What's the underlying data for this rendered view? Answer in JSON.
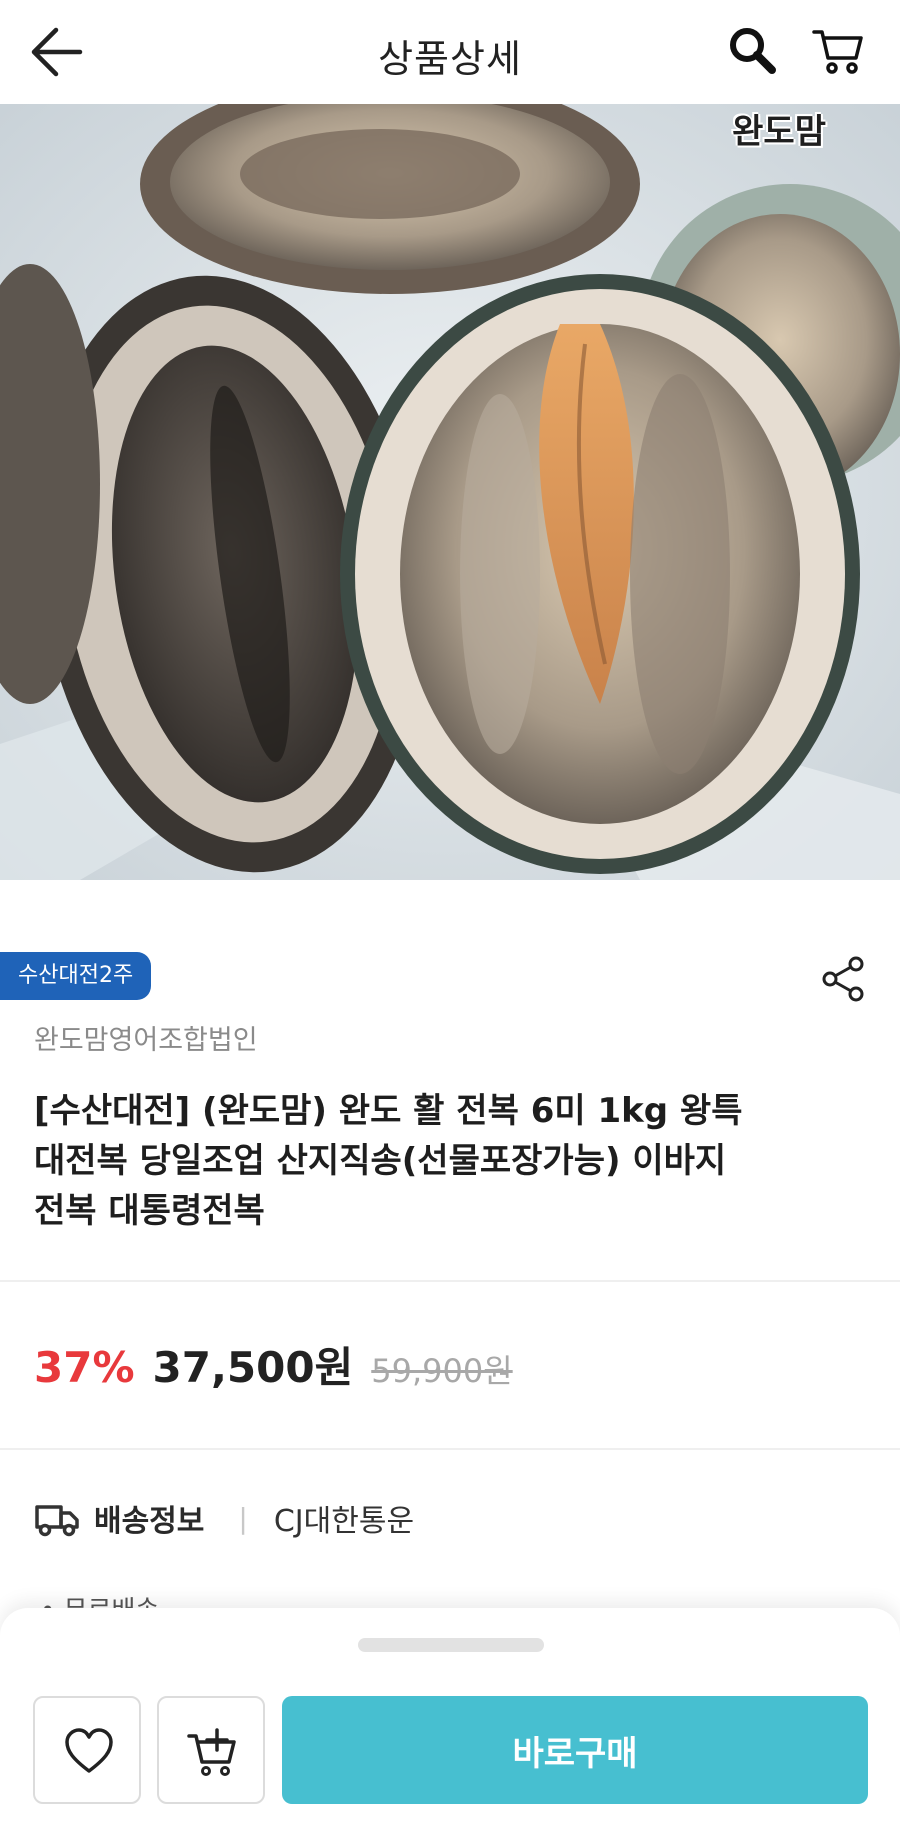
{
  "header": {
    "title": "상품상세",
    "icons": [
      "back-arrow-icon",
      "search-icon",
      "cart-icon"
    ]
  },
  "hero": {
    "watermark": "완도맘"
  },
  "product": {
    "badge": "수산대전2주",
    "seller": "완도맘영어조합법인",
    "title": "[수산대전] (완도맘) 완도 활 전복 6미 1kg 왕특대전복 당일조업 산지직송(선물포장가능) 이바지전복 대통령전복"
  },
  "price": {
    "discount": "37%",
    "current": "37,500원",
    "original": "59,900원",
    "discount_color": "#e8393c"
  },
  "shipping": {
    "label": "배송정보",
    "carrier": "CJ대한통운",
    "peek_text": "• 무료배송"
  },
  "bottom_bar": {
    "buy_label": "바로구매",
    "buy_color": "#47bfd0",
    "icons": [
      "heart-icon",
      "add-to-cart-icon"
    ]
  },
  "colors": {
    "badge": "#1f63b8"
  }
}
